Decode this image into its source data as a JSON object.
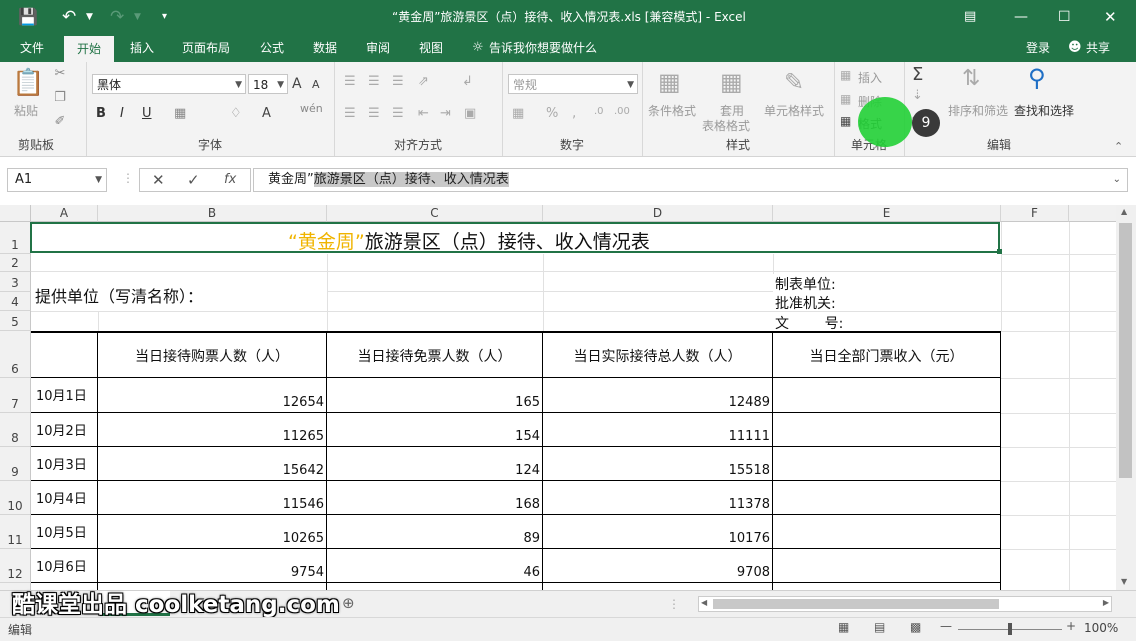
{
  "window": {
    "title": "“黄金周”旅游景区（点）接待、收入情况表.xls  [兼容模式] - Excel"
  },
  "menu": {
    "tabs": [
      "文件",
      "开始",
      "插入",
      "页面布局",
      "公式",
      "数据",
      "审阅",
      "视图"
    ],
    "tell_me": "告诉我你想要做什么",
    "login": "登录",
    "share": "共享"
  },
  "ribbon": {
    "clipboard": {
      "paste": "粘贴",
      "label": "剪贴板"
    },
    "font": {
      "name": "黑体",
      "size": "18",
      "label": "字体",
      "bold": "B",
      "italic": "I",
      "underline": "U",
      "grow": "A",
      "shrink": "A"
    },
    "alignment": {
      "label": "对齐方式"
    },
    "number": {
      "format": "常规",
      "label": "数字",
      "percent": "%"
    },
    "styles": {
      "conditional": "条件格式",
      "table_l1": "套用",
      "table_l2": "表格格式",
      "cell_styles": "单元格样式",
      "label": "样式"
    },
    "cells": {
      "insert": "插入",
      "delete": "删除",
      "format": "格式",
      "label": "单元格"
    },
    "editing": {
      "sort": "排序和筛选",
      "find": "查找和选择",
      "label": "编辑"
    }
  },
  "badge": "9",
  "formula": {
    "name_box": "A1",
    "content_prefix": "黄金周”",
    "content_rest": "旅游景区（点）接待、收入情况表"
  },
  "columns": [
    "A",
    "B",
    "C",
    "D",
    "E",
    "F"
  ],
  "rows": [
    "1",
    "2",
    "3",
    "4",
    "5",
    "6",
    "7",
    "8",
    "9",
    "10",
    "11",
    "12"
  ],
  "sheet": {
    "title_quote": "“黄金周”",
    "title_rest": "旅游景区（点）接待、收入情况表",
    "provider": "提供单位（写清名称）：",
    "maker": "制表单位:",
    "approver": "批准机关:",
    "doc_no": "文        号:",
    "headers": [
      "当日接待购票人数（人）",
      "当日接待免票人数（人）",
      "当日实际接待总人数（人）",
      "当日全部门票收入（元）"
    ],
    "data": [
      {
        "date": "10月1日",
        "paid": "12654",
        "free": "165",
        "total": "12489"
      },
      {
        "date": "10月2日",
        "paid": "11265",
        "free": "154",
        "total": "11111"
      },
      {
        "date": "10月3日",
        "paid": "15642",
        "free": "124",
        "total": "15518"
      },
      {
        "date": "10月4日",
        "paid": "11546",
        "free": "168",
        "total": "11378"
      },
      {
        "date": "10月5日",
        "paid": "10265",
        "free": "89",
        "total": "10176"
      },
      {
        "date": "10月6日",
        "paid": "9754",
        "free": "46",
        "total": "9708"
      }
    ]
  },
  "watermark": "酷课堂出品 coolketang.com",
  "status": {
    "mode": "编辑",
    "zoom": "100%"
  },
  "colors": {
    "excel_green": "#217346",
    "title_gold": "#f0b400",
    "cursor_green": "#22d036"
  }
}
